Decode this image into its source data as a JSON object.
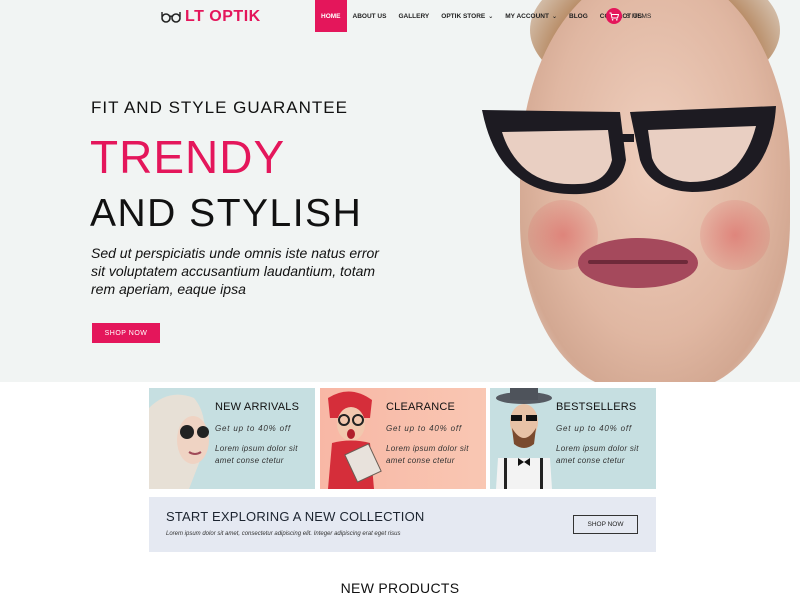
{
  "brand": {
    "name": "LT OPTIK",
    "accent": "#e4165b"
  },
  "nav": {
    "items": [
      {
        "label": "HOME",
        "active": true,
        "dropdown": false
      },
      {
        "label": "ABOUT US",
        "active": false,
        "dropdown": false
      },
      {
        "label": "GALLERY",
        "active": false,
        "dropdown": false
      },
      {
        "label": "OPTIK STORE",
        "active": false,
        "dropdown": true
      },
      {
        "label": "MY ACCOUNT",
        "active": false,
        "dropdown": true
      },
      {
        "label": "BLOG",
        "active": false,
        "dropdown": false
      },
      {
        "label": "CONTACT US",
        "active": false,
        "dropdown": false
      }
    ],
    "cart": {
      "label": "6 ITEMS",
      "icon": "cart-icon"
    }
  },
  "hero": {
    "kicker": "FIT AND STYLE GUARANTEE",
    "title": "TRENDY",
    "subtitle": "AND STYLISH",
    "paragraph": "Sed ut perspiciatis unde omnis iste natus error sit voluptatem accusantium laudantium, totam rem aperiam, eaque ipsa",
    "button": "SHOP NOW"
  },
  "promos": [
    {
      "title": "NEW ARRIVALS",
      "offer": "Get up to 40% off",
      "desc": "Lorem ipsum dolor sit amet conse ctetur"
    },
    {
      "title": "CLEARANCE",
      "offer": "Get up to 40% off",
      "desc": "Lorem ipsum dolor sit amet conse ctetur"
    },
    {
      "title": "BESTSELLERS",
      "offer": "Get up to 40% off",
      "desc": "Lorem ipsum dolor sit amet conse ctetur"
    }
  ],
  "collection": {
    "title": "START EXPLORING A NEW COLLECTION",
    "text": "Lorem ipsum dolor sit amet, consectetur adipiscing elit. Integer adipiscing erat eget risus",
    "button": "SHOP NOW"
  },
  "section_title": "NEW PRODUCTS"
}
